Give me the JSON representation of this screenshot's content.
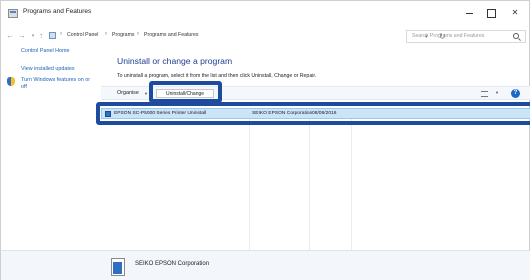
{
  "window": {
    "title": "Programs and Features"
  },
  "nav": {
    "breadcrumb": [
      "Control Panel",
      "Programs",
      "Programs and Features"
    ],
    "search_placeholder": "Search Programs and Features"
  },
  "sidebar": {
    "items": [
      {
        "label": "Control Panel Home"
      },
      {
        "label": "View installed updates"
      },
      {
        "label": "Turn Windows features on or off"
      }
    ]
  },
  "main": {
    "heading": "Uninstall or change a program",
    "subtext": "To uninstall a program, select it from the list and then click Uninstall, Change or Repair.",
    "toolbar": {
      "organise_label": "Organise",
      "uninstall_label": "Uninstall/Change"
    },
    "programs": [
      {
        "name": "EPSON SC-P5000 Series Printer Uninstall",
        "publisher": "SEIKO EPSON Corporation",
        "installed_on": "08/08/2016"
      }
    ]
  },
  "details": {
    "publisher": "SEIKO EPSON Corporation"
  },
  "colors": {
    "highlight_border": "#1f4b9e",
    "selected_row": "#cce4f7",
    "heading": "#1e3d8f",
    "link": "#1c63b7"
  }
}
